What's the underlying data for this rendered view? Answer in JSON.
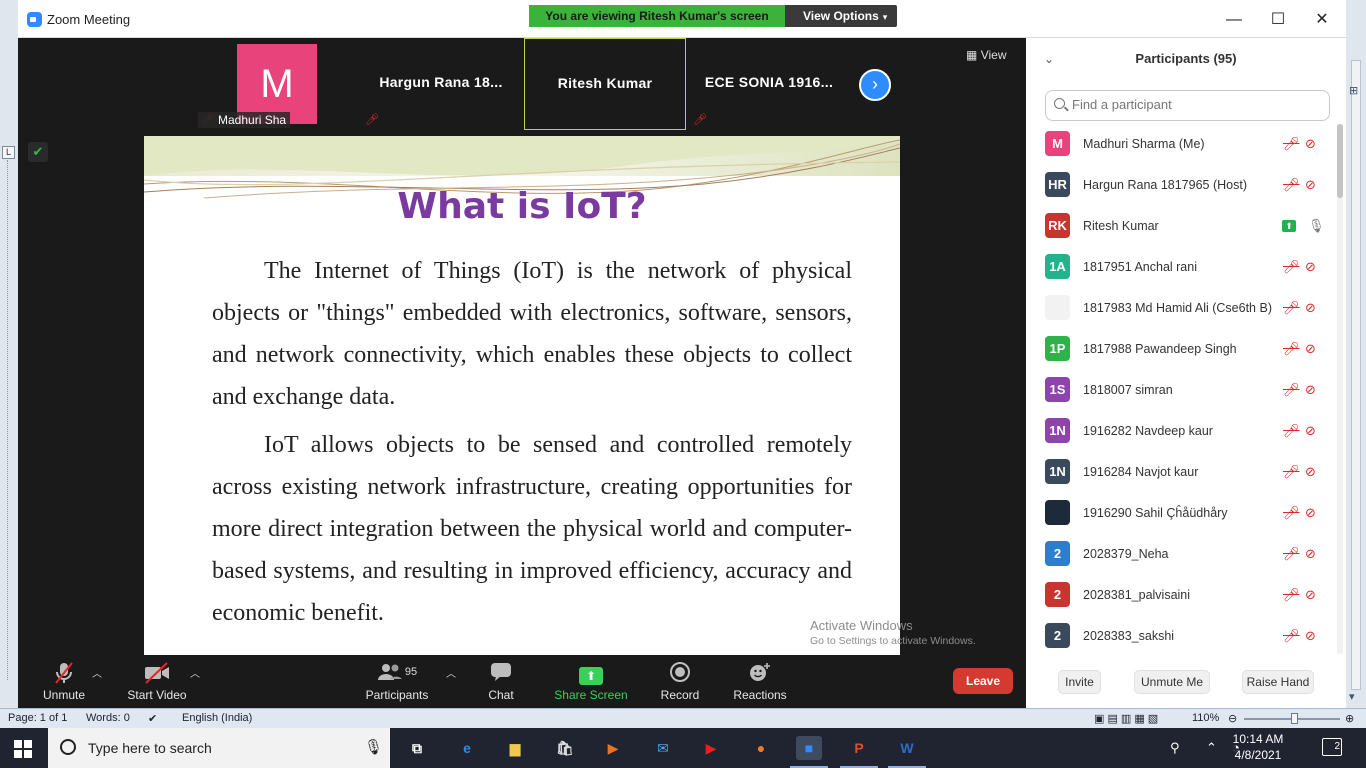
{
  "window": {
    "title": "Zoom Meeting",
    "viewing_banner": "You are viewing Ritesh Kumar's screen",
    "view_options": "View Options"
  },
  "thumbnails": [
    {
      "name": "Madhuri Sha",
      "initial": "M",
      "avatar_color": "#e8437a"
    },
    {
      "name": "Hargun  Rana  18..."
    },
    {
      "name": "Ritesh Kumar"
    },
    {
      "name": "ECE SONIA  1916..."
    }
  ],
  "view_label": "View",
  "slide": {
    "title": "What is IoT?",
    "paragraphs": [
      "The Internet of Things (IoT) is the network of physical objects or \"things\" embedded with electronics, software, sensors, and network connectivity, which enables these objects to collect and exchange data.",
      "IoT allows objects to be sensed and controlled remotely across existing network infrastructure, creating opportunities for more direct integration between the physical world and computer-based systems, and resulting in improved efficiency, accuracy and economic benefit."
    ]
  },
  "watermark": {
    "line1": "Activate Windows",
    "line2": "Go to Settings to activate Windows."
  },
  "toolbar": {
    "unmute": "Unmute",
    "start_video": "Start Video",
    "participants": "Participants",
    "participant_count": "95",
    "chat": "Chat",
    "share_screen": "Share Screen",
    "record": "Record",
    "reactions": "Reactions",
    "leave": "Leave"
  },
  "panel": {
    "title": "Participants (95)",
    "search_placeholder": "Find a participant",
    "participants": [
      {
        "initials": "M",
        "color": "#e8437a",
        "name": "Madhuri Sharma (Me)"
      },
      {
        "initials": "HR",
        "color": "#3a4a5c",
        "name": "Hargun Rana 1817965 (Host)"
      },
      {
        "initials": "RK",
        "color": "#c8352f",
        "name": "Ritesh Kumar"
      },
      {
        "initials": "1A",
        "color": "#23b38c",
        "name": "1817951 Anchal rani"
      },
      {
        "initials": "",
        "color": "#f2f2f2",
        "name": "1817983 Md Hamid Ali (Cse6th B)"
      },
      {
        "initials": "1P",
        "color": "#2fb24a",
        "name": "1817988 Pawandeep Singh"
      },
      {
        "initials": "1S",
        "color": "#8e44ad",
        "name": "1818007 simran"
      },
      {
        "initials": "1N",
        "color": "#8e44ad",
        "name": "1916282 Navdeep kaur"
      },
      {
        "initials": "1N",
        "color": "#3a4a5c",
        "name": "1916284 Navjot kaur"
      },
      {
        "initials": "",
        "color": "#1c2a3a",
        "name": "1916290 Sahil Çĥåüdhåry"
      },
      {
        "initials": "2",
        "color": "#2a7fd0",
        "name": "2028379_Neha"
      },
      {
        "initials": "2",
        "color": "#c8352f",
        "name": "2028381_palvisaini"
      },
      {
        "initials": "2",
        "color": "#3a4a5c",
        "name": "2028383_sakshi"
      }
    ],
    "invite": "Invite",
    "unmute_me": "Unmute Me",
    "raise_hand": "Raise Hand"
  },
  "statusbar": {
    "page": "Page: 1 of 1",
    "words": "Words: 0",
    "language": "English (India)",
    "zoom": "110%"
  },
  "taskbar": {
    "search_placeholder": "Type here to search",
    "time": "10:14 AM",
    "date": "4/8/2021",
    "notifications": "2"
  }
}
